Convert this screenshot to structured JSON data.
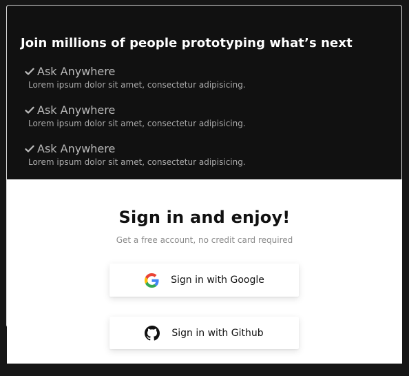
{
  "promo": {
    "headline": "Join millions of people prototyping what’s next",
    "features": [
      {
        "title": "Ask Anywhere",
        "description": "Lorem ipsum dolor sit amet, consectetur adipisicing.",
        "icon": "check-icon"
      },
      {
        "title": "Ask Anywhere",
        "description": "Lorem ipsum dolor sit amet, consectetur adipisicing.",
        "icon": "check-icon"
      },
      {
        "title": "Ask Anywhere",
        "description": "Lorem ipsum dolor sit amet, consectetur adipisicing.",
        "icon": "check-icon"
      }
    ]
  },
  "signin": {
    "title": "Sign in and enjoy!",
    "subtitle": "Get a free account, no credit card required",
    "buttons": {
      "google": {
        "label": "Sign in with Google",
        "icon": "google-icon"
      },
      "github": {
        "label": "Sign in with Github",
        "icon": "github-icon"
      }
    }
  },
  "colors": {
    "background": "#161616",
    "promo_panel": "#111111",
    "signin_panel": "#ffffff",
    "heading_dark": "#111111",
    "muted_text": "#8b8b8b",
    "feature_text": "#b9b9b9"
  }
}
